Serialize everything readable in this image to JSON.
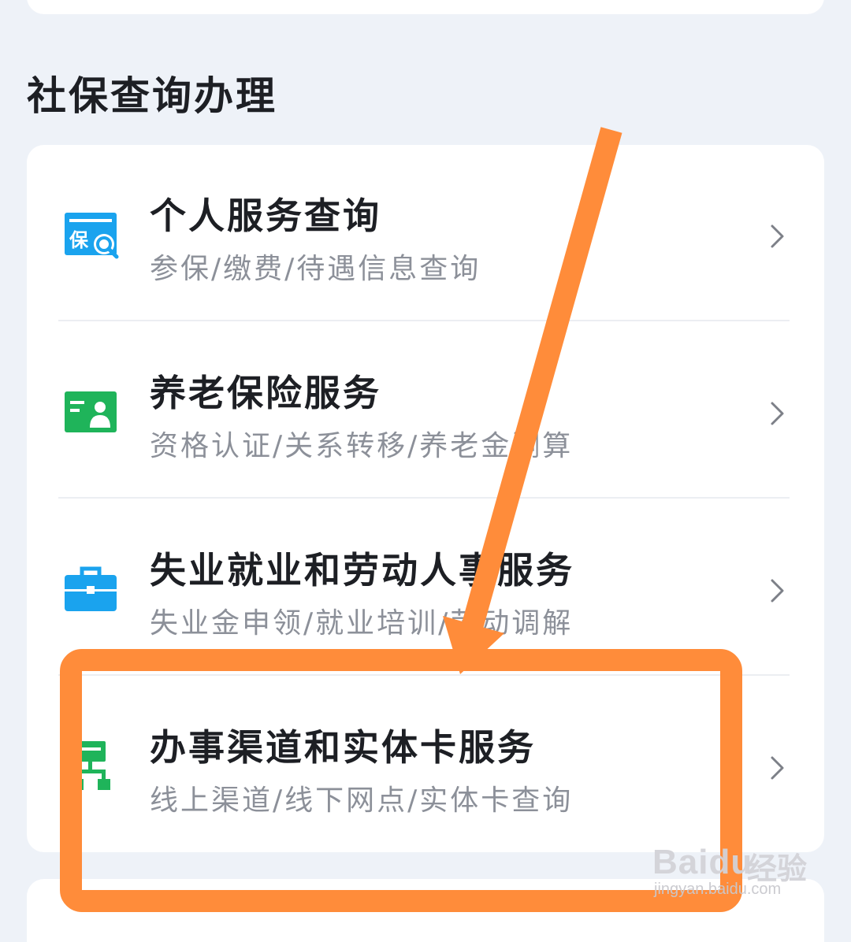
{
  "section": {
    "title": "社保查询办理"
  },
  "services": [
    {
      "title": "个人服务查询",
      "subtitle": "参保/缴费/待遇信息查询",
      "icon": "social-insurance-search-icon",
      "color": "#1aa3ee"
    },
    {
      "title": "养老保险服务",
      "subtitle": "资格认证/关系转移/养老金测算",
      "icon": "pension-card-icon",
      "color": "#1fb45a"
    },
    {
      "title": "失业就业和劳动人事服务",
      "subtitle": "失业金申领/就业培训/劳动调解",
      "icon": "briefcase-icon",
      "color": "#1aa3ee"
    },
    {
      "title": "办事渠道和实体卡服务",
      "subtitle": "线上渠道/线下网点/实体卡查询",
      "icon": "service-network-icon",
      "color": "#1fb45a"
    }
  ],
  "annotation": {
    "color": "#ff8c3a"
  },
  "watermark": {
    "brand": "Baidu",
    "brand_cn": "经验",
    "url": "jingyan.baidu.com"
  }
}
